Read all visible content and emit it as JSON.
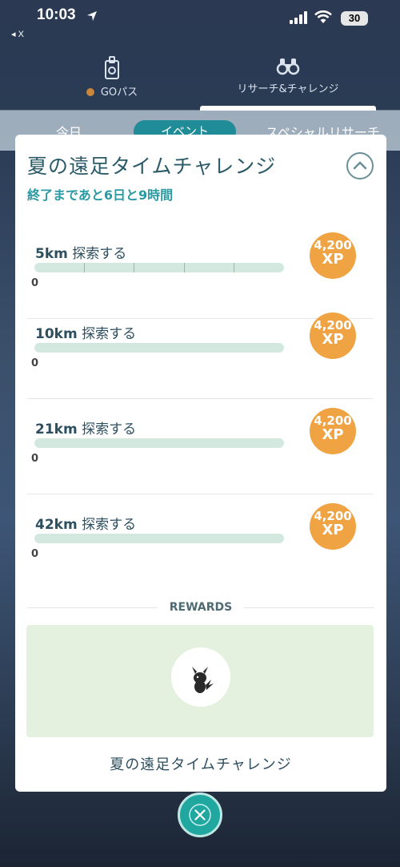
{
  "status_bar": {
    "time": "10:03",
    "battery": "30",
    "back_app": "◂ X"
  },
  "top_tabs": [
    {
      "label": "GOパス",
      "icon": "go-pass-icon"
    },
    {
      "label": "リサーチ&チャレンジ",
      "icon": "binoculars-icon"
    }
  ],
  "sub_tabs": [
    "今日",
    "イベント",
    "スペシャルリサーチ"
  ],
  "challenge": {
    "title": "夏の遠足タイムチャレンジ",
    "time_left": "終了まであと6日と9時間",
    "tasks": [
      {
        "distance": "5km",
        "action": "探索する",
        "progress": "0",
        "progress_value": 0,
        "reward_amount": "4,200",
        "reward_unit": "XP"
      },
      {
        "distance": "10km",
        "action": "探索する",
        "progress": "0",
        "progress_value": 0,
        "reward_amount": "4,200",
        "reward_unit": "XP"
      },
      {
        "distance": "21km",
        "action": "探索する",
        "progress": "0",
        "progress_value": 0,
        "reward_amount": "4,200",
        "reward_unit": "XP"
      },
      {
        "distance": "42km",
        "action": "探索する",
        "progress": "0",
        "progress_value": 0,
        "reward_amount": "4,200",
        "reward_unit": "XP"
      }
    ],
    "rewards_label": "REWARDS",
    "reward_icon": "pikachu-icon",
    "footer_title": "夏の遠足タイムチャレンジ"
  },
  "colors": {
    "accent": "#1f8c97",
    "xp_badge": "#f0a343",
    "bar": "#d3e9e0",
    "reward_bg": "#e5f1df"
  }
}
